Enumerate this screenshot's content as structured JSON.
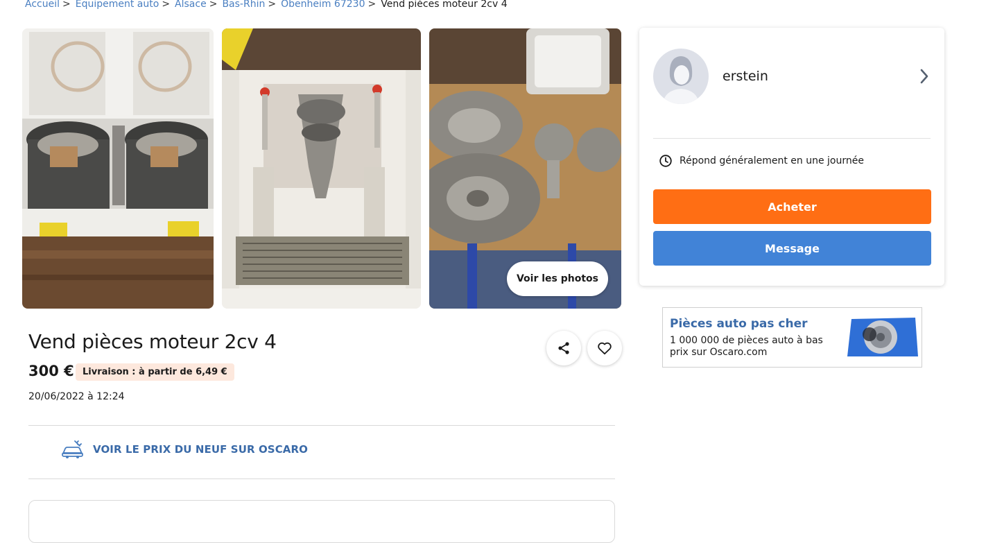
{
  "breadcrumb": {
    "items": [
      "Accueil",
      "Équipement auto",
      "Alsace",
      "Bas-Rhin",
      "Obenheim 67230"
    ],
    "separator": ">",
    "current": "Vend pièces moteur 2cv 4"
  },
  "gallery": {
    "see_photos_label": "Voir les photos",
    "images": [
      "engine-cylinders-photo",
      "crankshaft-photo",
      "brake-discs-photo"
    ]
  },
  "listing": {
    "title": "Vend pièces moteur 2cv 4",
    "price": "300 €",
    "delivery": "Livraison : à partir de 6,49 €",
    "date": "20/06/2022 à 12:24",
    "oscaro_link": "VOIR LE PRIX DU NEUF SUR OSCARO"
  },
  "actions": {
    "share_icon": "share-icon",
    "favorite_icon": "heart-icon"
  },
  "seller": {
    "name": "erstein",
    "response": "Répond généralement en une journée",
    "buy_label": "Acheter",
    "message_label": "Message"
  },
  "ad": {
    "title": "Pièces auto pas cher",
    "body": "1 000 000 de pièces auto à bas prix sur Oscaro.com"
  },
  "colors": {
    "link": "#4a7fc1",
    "buy": "#ff6e14",
    "message": "#4183d7",
    "badge_bg": "#fde8dd",
    "oscaro_blue": "#3a6aa8"
  }
}
